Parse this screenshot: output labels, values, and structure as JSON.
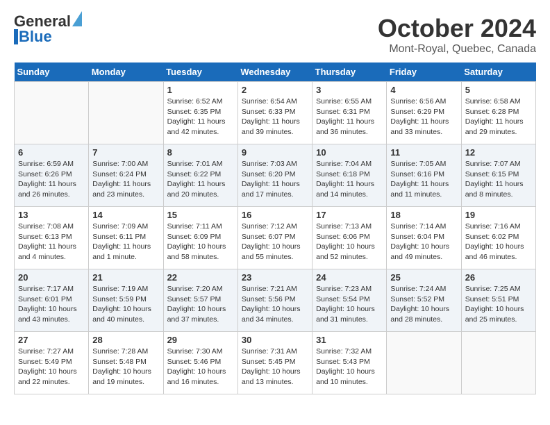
{
  "logo": {
    "general": "General",
    "blue": "Blue"
  },
  "title": "October 2024",
  "subtitle": "Mont-Royal, Quebec, Canada",
  "days_of_week": [
    "Sunday",
    "Monday",
    "Tuesday",
    "Wednesday",
    "Thursday",
    "Friday",
    "Saturday"
  ],
  "weeks": [
    [
      {
        "day": "",
        "info": ""
      },
      {
        "day": "",
        "info": ""
      },
      {
        "day": "1",
        "info": "Sunrise: 6:52 AM\nSunset: 6:35 PM\nDaylight: 11 hours and 42 minutes."
      },
      {
        "day": "2",
        "info": "Sunrise: 6:54 AM\nSunset: 6:33 PM\nDaylight: 11 hours and 39 minutes."
      },
      {
        "day": "3",
        "info": "Sunrise: 6:55 AM\nSunset: 6:31 PM\nDaylight: 11 hours and 36 minutes."
      },
      {
        "day": "4",
        "info": "Sunrise: 6:56 AM\nSunset: 6:29 PM\nDaylight: 11 hours and 33 minutes."
      },
      {
        "day": "5",
        "info": "Sunrise: 6:58 AM\nSunset: 6:28 PM\nDaylight: 11 hours and 29 minutes."
      }
    ],
    [
      {
        "day": "6",
        "info": "Sunrise: 6:59 AM\nSunset: 6:26 PM\nDaylight: 11 hours and 26 minutes."
      },
      {
        "day": "7",
        "info": "Sunrise: 7:00 AM\nSunset: 6:24 PM\nDaylight: 11 hours and 23 minutes."
      },
      {
        "day": "8",
        "info": "Sunrise: 7:01 AM\nSunset: 6:22 PM\nDaylight: 11 hours and 20 minutes."
      },
      {
        "day": "9",
        "info": "Sunrise: 7:03 AM\nSunset: 6:20 PM\nDaylight: 11 hours and 17 minutes."
      },
      {
        "day": "10",
        "info": "Sunrise: 7:04 AM\nSunset: 6:18 PM\nDaylight: 11 hours and 14 minutes."
      },
      {
        "day": "11",
        "info": "Sunrise: 7:05 AM\nSunset: 6:16 PM\nDaylight: 11 hours and 11 minutes."
      },
      {
        "day": "12",
        "info": "Sunrise: 7:07 AM\nSunset: 6:15 PM\nDaylight: 11 hours and 8 minutes."
      }
    ],
    [
      {
        "day": "13",
        "info": "Sunrise: 7:08 AM\nSunset: 6:13 PM\nDaylight: 11 hours and 4 minutes."
      },
      {
        "day": "14",
        "info": "Sunrise: 7:09 AM\nSunset: 6:11 PM\nDaylight: 11 hours and 1 minute."
      },
      {
        "day": "15",
        "info": "Sunrise: 7:11 AM\nSunset: 6:09 PM\nDaylight: 10 hours and 58 minutes."
      },
      {
        "day": "16",
        "info": "Sunrise: 7:12 AM\nSunset: 6:07 PM\nDaylight: 10 hours and 55 minutes."
      },
      {
        "day": "17",
        "info": "Sunrise: 7:13 AM\nSunset: 6:06 PM\nDaylight: 10 hours and 52 minutes."
      },
      {
        "day": "18",
        "info": "Sunrise: 7:14 AM\nSunset: 6:04 PM\nDaylight: 10 hours and 49 minutes."
      },
      {
        "day": "19",
        "info": "Sunrise: 7:16 AM\nSunset: 6:02 PM\nDaylight: 10 hours and 46 minutes."
      }
    ],
    [
      {
        "day": "20",
        "info": "Sunrise: 7:17 AM\nSunset: 6:01 PM\nDaylight: 10 hours and 43 minutes."
      },
      {
        "day": "21",
        "info": "Sunrise: 7:19 AM\nSunset: 5:59 PM\nDaylight: 10 hours and 40 minutes."
      },
      {
        "day": "22",
        "info": "Sunrise: 7:20 AM\nSunset: 5:57 PM\nDaylight: 10 hours and 37 minutes."
      },
      {
        "day": "23",
        "info": "Sunrise: 7:21 AM\nSunset: 5:56 PM\nDaylight: 10 hours and 34 minutes."
      },
      {
        "day": "24",
        "info": "Sunrise: 7:23 AM\nSunset: 5:54 PM\nDaylight: 10 hours and 31 minutes."
      },
      {
        "day": "25",
        "info": "Sunrise: 7:24 AM\nSunset: 5:52 PM\nDaylight: 10 hours and 28 minutes."
      },
      {
        "day": "26",
        "info": "Sunrise: 7:25 AM\nSunset: 5:51 PM\nDaylight: 10 hours and 25 minutes."
      }
    ],
    [
      {
        "day": "27",
        "info": "Sunrise: 7:27 AM\nSunset: 5:49 PM\nDaylight: 10 hours and 22 minutes."
      },
      {
        "day": "28",
        "info": "Sunrise: 7:28 AM\nSunset: 5:48 PM\nDaylight: 10 hours and 19 minutes."
      },
      {
        "day": "29",
        "info": "Sunrise: 7:30 AM\nSunset: 5:46 PM\nDaylight: 10 hours and 16 minutes."
      },
      {
        "day": "30",
        "info": "Sunrise: 7:31 AM\nSunset: 5:45 PM\nDaylight: 10 hours and 13 minutes."
      },
      {
        "day": "31",
        "info": "Sunrise: 7:32 AM\nSunset: 5:43 PM\nDaylight: 10 hours and 10 minutes."
      },
      {
        "day": "",
        "info": ""
      },
      {
        "day": "",
        "info": ""
      }
    ]
  ]
}
